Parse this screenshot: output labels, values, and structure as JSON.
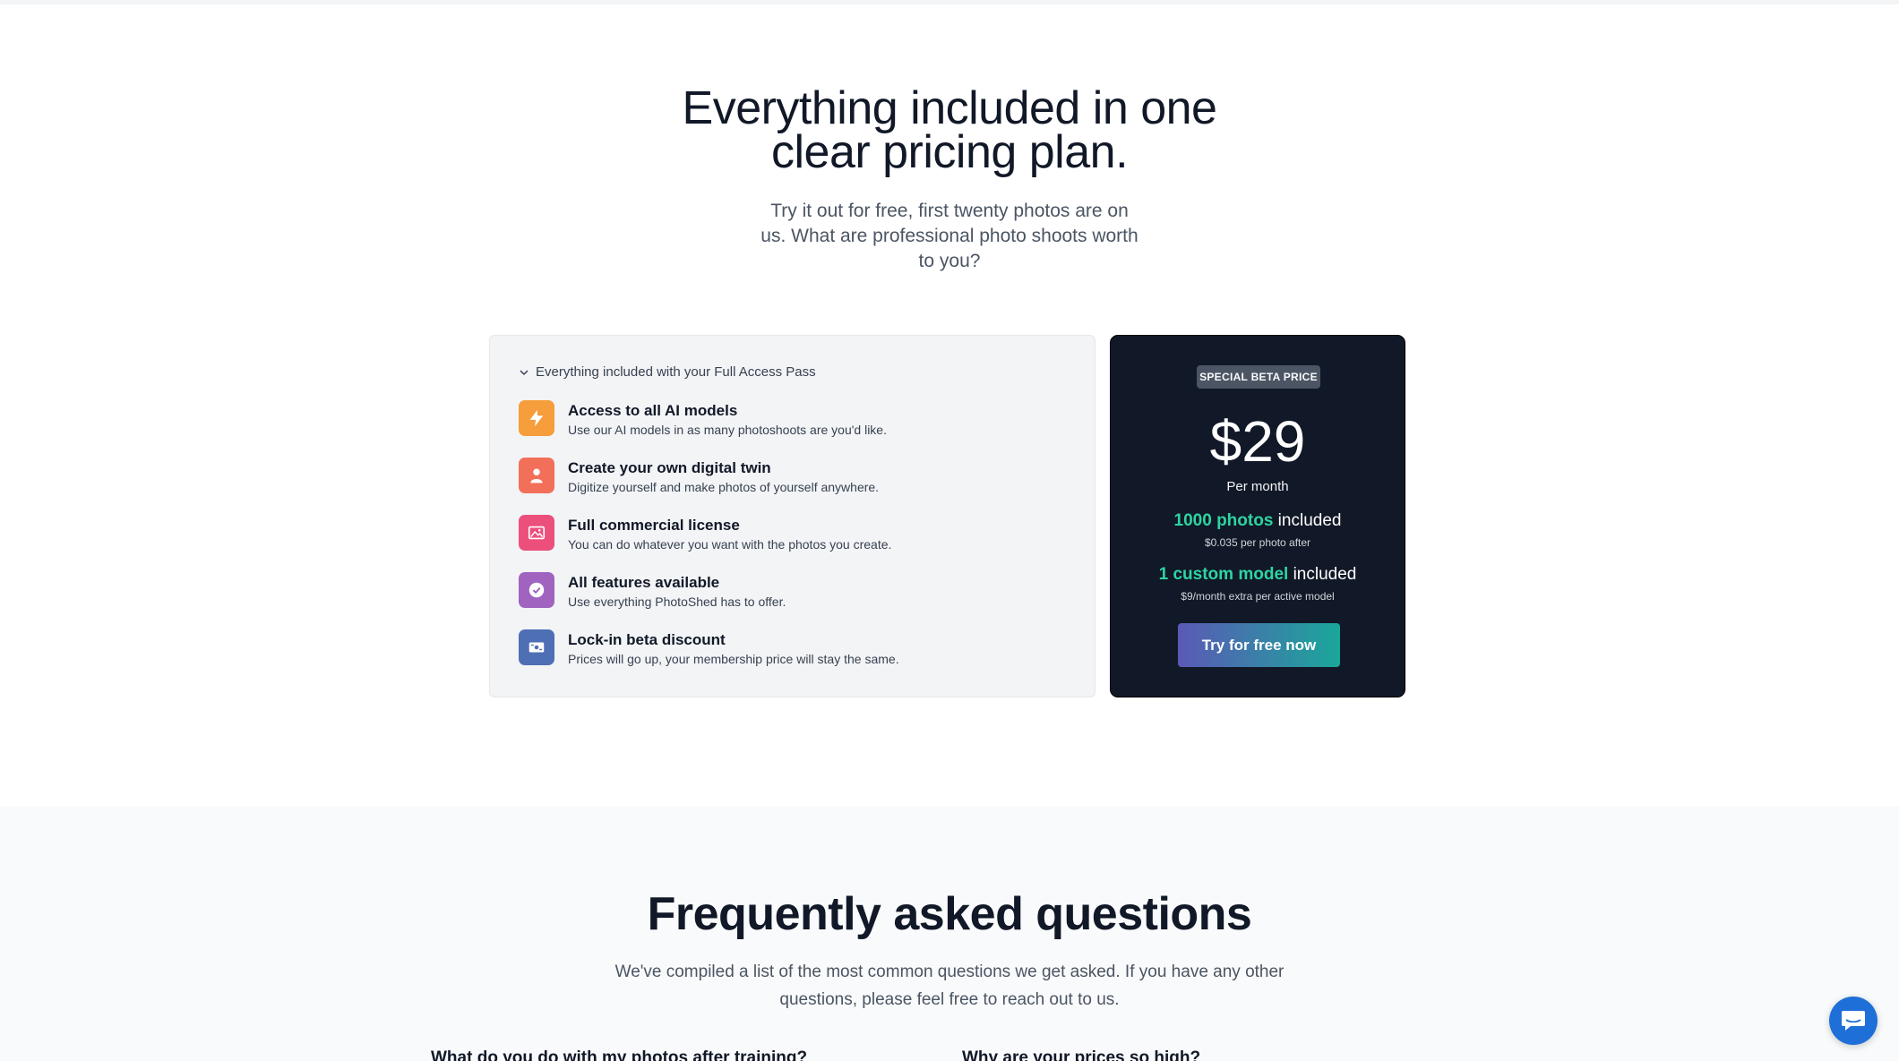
{
  "hero": {
    "title_line1": "Everything included in one",
    "title_line2": "clear pricing plan.",
    "subtitle_line1": "Try it out for free, first twenty photos are on",
    "subtitle_line2": "us. What are professional photo shoots worth",
    "subtitle_line3": "to you?"
  },
  "features": {
    "toggle_label": "Everything included with your Full Access Pass",
    "items": [
      {
        "title": "Access to all AI models",
        "description": "Use our AI models in as many photoshoots are you'd like.",
        "icon": "lightning-icon",
        "color": "#f59e3b"
      },
      {
        "title": "Create your own digital twin",
        "description": "Digitize yourself and make photos of yourself anywhere.",
        "icon": "user-icon",
        "color": "#f2705a"
      },
      {
        "title": "Full commercial license",
        "description": "You can do whatever you want with the photos you create.",
        "icon": "image-icon",
        "color": "#ec4f7c"
      },
      {
        "title": "All features available",
        "description": "Use everything PhotoShed has to offer.",
        "icon": "badge-check-icon",
        "color": "#a063c0"
      },
      {
        "title": "Lock-in beta discount",
        "description": "Prices will go up, your membership price will stay the same.",
        "icon": "ticket-icon",
        "color": "#4f6fb5"
      }
    ]
  },
  "pricing": {
    "badge": "SPECIAL BETA PRICE",
    "price": "$29",
    "period": "Per month",
    "photos_highlight": "1000 photos",
    "photos_suffix": " included",
    "photos_sub": "$0.035 per photo after",
    "model_highlight": "1 custom model",
    "model_suffix": " included",
    "model_sub": "$9/month extra per active model",
    "cta_label": "Try for free now",
    "accent_color": "#2dd4a2"
  },
  "faq": {
    "title": "Frequently asked questions",
    "subtitle_line1": "We've compiled a list of the most common questions we get asked. If you have any other",
    "subtitle_line2": "questions, please feel free to reach out to us.",
    "questions": [
      "What do you do with my photos after training?",
      "Why are your prices so high?"
    ]
  },
  "chat": {
    "icon": "chat-bubble-icon"
  }
}
